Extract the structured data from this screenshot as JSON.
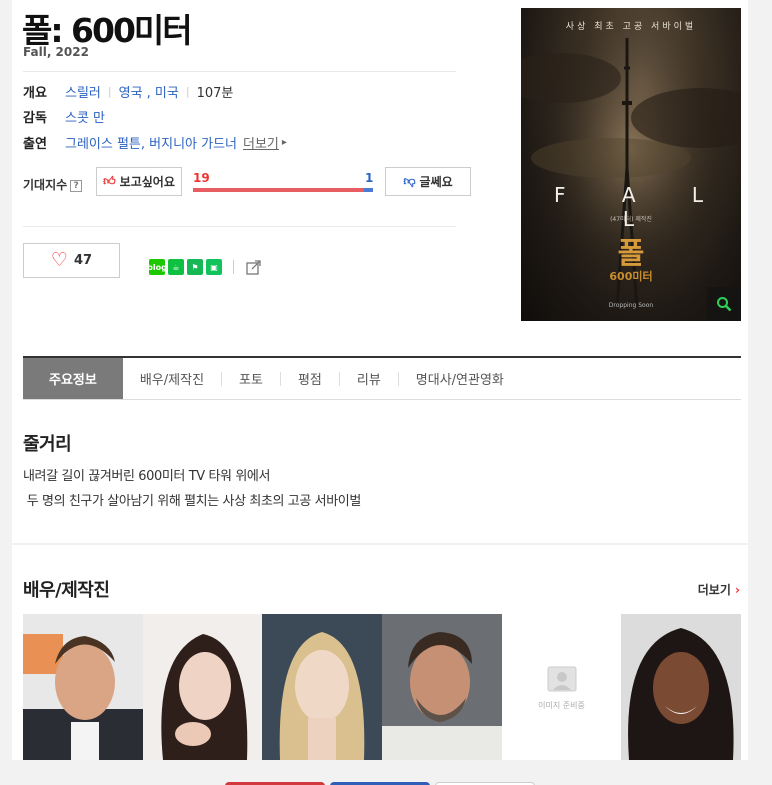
{
  "movie": {
    "title": "폴: 600미터",
    "subtitle": "Fall, 2022"
  },
  "info": {
    "overview_label": "개요",
    "genre": "스릴러",
    "countries": "영국 , 미국",
    "runtime": "107분",
    "director_label": "감독",
    "director": "스콧 만",
    "cast_label": "출연",
    "cast": "그레이스 펄튼, 버지니아 가드너",
    "more": "더보기"
  },
  "expectation": {
    "label": "기대지수",
    "help": "?",
    "want_label": "보고싶어요",
    "meh_label": "글쎄요",
    "want_count": "19",
    "meh_count": "1",
    "want_ratio": 0.95,
    "colors": {
      "want": "#e75d62",
      "meh": "#4a7cd4"
    }
  },
  "like": {
    "count": "47"
  },
  "share": {
    "icons": [
      "blog-icon",
      "cafe-icon",
      "bookmark-icon",
      "band-icon"
    ],
    "band_label": "blog"
  },
  "poster": {
    "tagline": "사상 최초 고공 서바이벌",
    "title_en": "F A L L",
    "credit": "(47미터) 제작진",
    "title_ko": "폴",
    "subtitle_ko": "600미터",
    "release": "Dropping Soon"
  },
  "tabs": [
    "주요정보",
    "배우/제작진",
    "포토",
    "평점",
    "리뷰",
    "명대사/연관영화"
  ],
  "synopsis": {
    "heading": "줄거리",
    "line1": "내려갈 길이 끊겨버린 600미터 TV 타워 위에서",
    "line2": " 두 명의 친구가 살아남기 위해 펼치는 사상 최초의 고공 서바이벌"
  },
  "cast_section": {
    "heading": "배우/제작진",
    "more": "더보기",
    "no_image_text": "이미지 준비중"
  }
}
